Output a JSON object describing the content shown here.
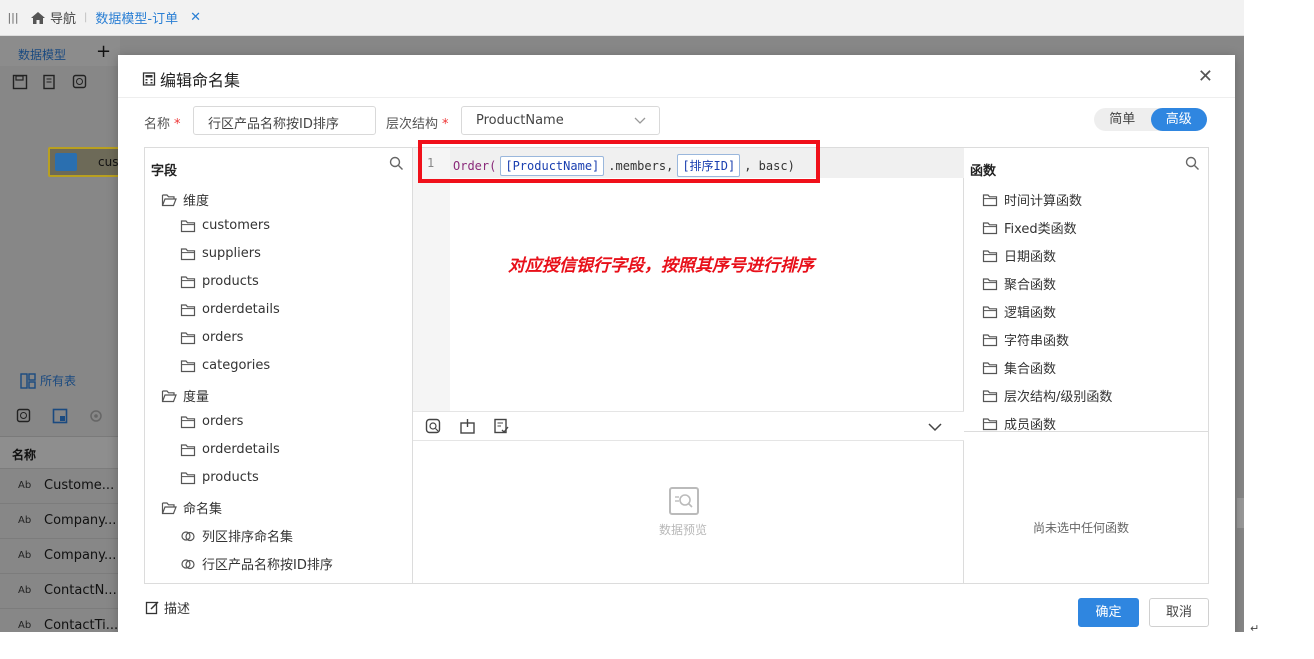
{
  "topbar": {
    "menu_icon": "menu-icon",
    "home_label": "导航",
    "tab_label": "数据模型-订单",
    "close_glyph": "✕"
  },
  "background": {
    "tab_label": "数据模型",
    "add_glyph": "+",
    "card_label": "cus",
    "all_tables_label": "所有表",
    "column_header": "名称",
    "rows": [
      {
        "type": "Ab",
        "name": "Custome..."
      },
      {
        "type": "Ab",
        "name": "Company..."
      },
      {
        "type": "Ab",
        "name": "Company..."
      },
      {
        "type": "Ab",
        "name": "ContactN..."
      },
      {
        "type": "Ab",
        "name": "ContactTi..."
      }
    ]
  },
  "modal": {
    "title": "编辑命名集",
    "close_glyph": "✕",
    "name_label": "名称",
    "name_value": "行区产品名称按ID排序",
    "hierarchy_label": "层次结构",
    "hierarchy_value": "ProductName",
    "required_mark": "*",
    "mode_simple": "简单",
    "mode_advanced": "高级",
    "active_mode": "高级"
  },
  "fields_pane": {
    "title": "字段",
    "groups": [
      {
        "label": "维度",
        "items": [
          "customers",
          "suppliers",
          "products",
          "orderdetails",
          "orders",
          "categories"
        ]
      },
      {
        "label": "度量",
        "items": [
          "orders",
          "orderdetails",
          "products"
        ]
      },
      {
        "label": "命名集",
        "items": [
          "列区排序命名集",
          "行区产品名称按ID排序"
        ]
      }
    ]
  },
  "editor": {
    "line_number": "1",
    "code_func": "Order(",
    "code_token1": "[ProductName]",
    "code_mid": ".members,",
    "code_token2": "[排序ID]",
    "code_end": ", basc)",
    "annotation": "对应授信银行字段，按照其序号进行排序",
    "preview_label": "数据预览"
  },
  "functions_pane": {
    "title": "函数",
    "items": [
      "时间计算函数",
      "Fixed类函数",
      "日期函数",
      "聚合函数",
      "逻辑函数",
      "字符串函数",
      "集合函数",
      "层次结构/级别函数",
      "成员函数"
    ],
    "empty_text": "尚未选中任何函数"
  },
  "footer": {
    "desc_label": "描述",
    "ok_label": "确定",
    "cancel_label": "取消"
  },
  "colors": {
    "accent": "#2f86e0",
    "annotation_red": "#e8101a"
  }
}
